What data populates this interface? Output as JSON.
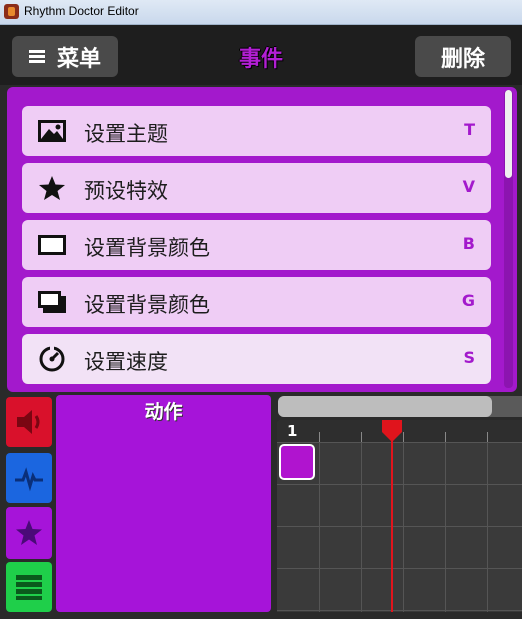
{
  "window": {
    "title": "Rhythm Doctor Editor"
  },
  "header": {
    "menu_label": "菜单",
    "title": "事件",
    "delete_label": "删除"
  },
  "events": [
    {
      "label": "设置主题",
      "key": "T",
      "icon": "image-icon"
    },
    {
      "label": "预设特效",
      "key": "V",
      "icon": "star-icon"
    },
    {
      "label": "设置背景颜色",
      "key": "B",
      "icon": "rectangle-icon"
    },
    {
      "label": "设置背景颜色",
      "key": "G",
      "icon": "stacked-rectangles-icon"
    },
    {
      "label": "设置速度",
      "key": "S",
      "icon": "speedometer-icon"
    }
  ],
  "tabs": [
    {
      "name": "sound",
      "icon": "speaker-icon",
      "color": "#d9112b"
    },
    {
      "name": "rows",
      "icon": "heartbeat-icon",
      "color": "#1b66e0"
    },
    {
      "name": "actions",
      "icon": "star-icon",
      "color": "#a614d9",
      "active": true
    },
    {
      "name": "rooms",
      "icon": "list-icon",
      "color": "#1fcf4a"
    }
  ],
  "actions_panel": {
    "title": "动作"
  },
  "timeline": {
    "bar_number": "1"
  },
  "colors": {
    "accent": "#a319cc",
    "item_bg": "#efcdf5",
    "playhead": "#e0141c"
  }
}
